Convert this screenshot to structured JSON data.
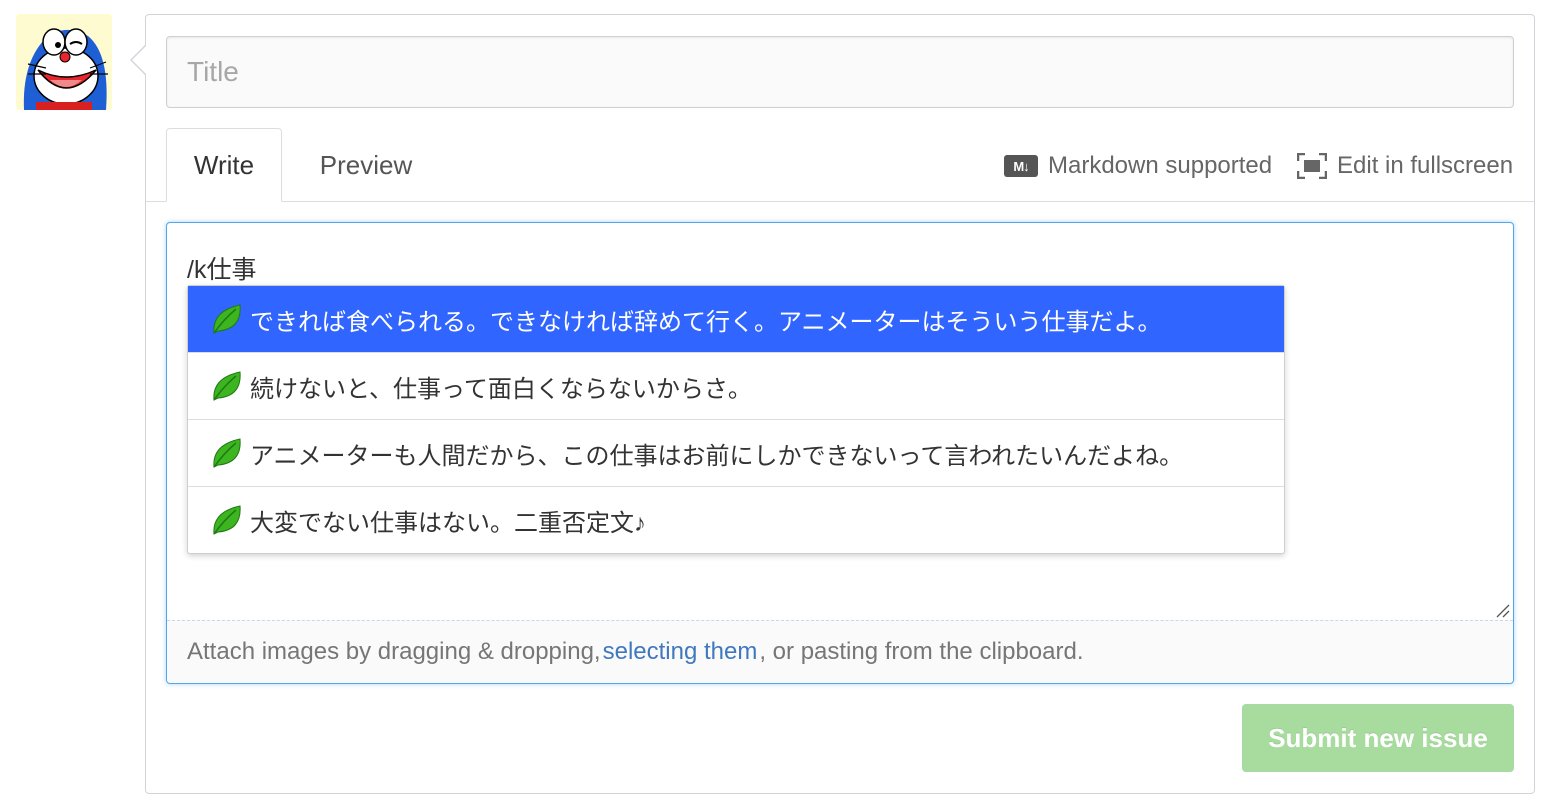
{
  "title_field": {
    "placeholder": "Title",
    "value": ""
  },
  "tabs": [
    {
      "label": "Write",
      "active": true
    },
    {
      "label": "Preview",
      "active": false
    }
  ],
  "toolbar": {
    "markdown_badge": "M↓",
    "markdown_label": "Markdown supported",
    "fullscreen_label": "Edit in fullscreen"
  },
  "editor": {
    "value": "/k仕事"
  },
  "suggestions": [
    {
      "icon": "leaf-icon",
      "text": "できれば食べられる。できなければ辞めて行く。アニメーターはそういう仕事だよ。",
      "selected": true
    },
    {
      "icon": "leaf-icon",
      "text": "続けないと、仕事って面白くならないからさ。",
      "selected": false
    },
    {
      "icon": "leaf-icon",
      "text": "アニメーターも人間だから、この仕事はお前にしかできないって言われたいんだよね。",
      "selected": false
    },
    {
      "icon": "leaf-icon",
      "text": "大変でない仕事はない。二重否定文♪",
      "selected": false
    }
  ],
  "drop_bar": {
    "prefix": "Attach images by dragging & dropping,",
    "link": "selecting them",
    "suffix": ", or pasting from the clipboard."
  },
  "submit": {
    "label": "Submit new issue",
    "disabled": true
  },
  "colors": {
    "selected_row": "#3065ff",
    "link": "#4078c0",
    "focus_border": "#51a7e8",
    "submit_disabled": "#a8dc9f"
  }
}
